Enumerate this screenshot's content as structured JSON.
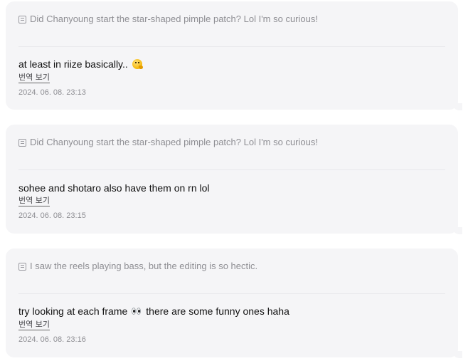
{
  "comments": [
    {
      "quote": "Did Chanyoung start the star-shaped pimple patch? Lol I'm so curious!",
      "message": "at least in riize basically..",
      "emoji": "thinking-face-icon",
      "message_after": "",
      "translate_label": "번역 보기",
      "timestamp": "2024. 06. 08. 23:13"
    },
    {
      "quote": "Did Chanyoung start the star-shaped pimple patch? Lol I'm so curious!",
      "message": "sohee and shotaro also have them on rn lol",
      "emoji": "",
      "message_after": "",
      "translate_label": "번역 보기",
      "timestamp": "2024. 06. 08. 23:15"
    },
    {
      "quote": "I saw the reels playing bass, but the editing is so hectic.",
      "message": "try looking at each frame",
      "emoji": "eyes-icon",
      "message_after": "there are some funny ones haha",
      "translate_label": "번역 보기",
      "timestamp": "2024. 06. 08. 23:16"
    }
  ]
}
